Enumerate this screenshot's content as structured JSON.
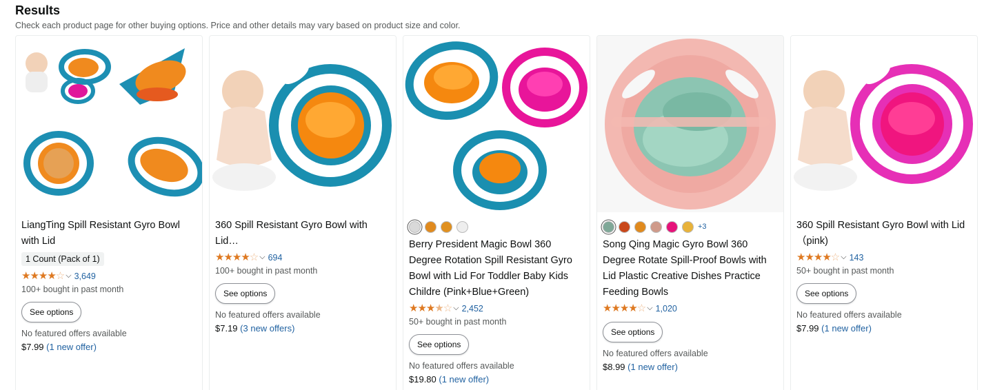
{
  "header": {
    "title": "Results",
    "subtitle": "Check each product page for other buying options. Price and other details may vary based on product size and color."
  },
  "products": [
    {
      "title": "LiangTing Spill Resistant Gyro Bowl with Lid",
      "variant": "1 Count (Pack of 1)",
      "rating": 4.0,
      "rating_count": "3,649",
      "bought": "100+ bought in past month",
      "button": "See options",
      "no_featured": "No featured offers available",
      "price": "$7.99",
      "offer": "(1 new offer)"
    },
    {
      "title": "360 Spill Resistant Gyro Bowl with Lid…",
      "rating": 4.0,
      "rating_count": "694",
      "bought": "100+ bought in past month",
      "button": "See options",
      "no_featured": "No featured offers available",
      "price": "$7.19",
      "offer": "(3 new offers)"
    },
    {
      "swatches": [
        "#d9d9d9",
        "#e08a1e",
        "#e0901f",
        "#eeeeee"
      ],
      "title": "Berry President Magic Bowl 360 Degree Rotation Spill Resistant Gyro Bowl with Lid For Toddler Baby Kids Childre (Pink+Blue+Green)",
      "rating": 3.5,
      "rating_count": "2,452",
      "bought": "50+ bought in past month",
      "button": "See options",
      "no_featured": "No featured offers available",
      "price": "$19.80",
      "offer": "(1 new offer)"
    },
    {
      "swatches": [
        "#7fa898",
        "#c9471a",
        "#e08a1e",
        "#cf9a8a",
        "#e6127a",
        "#e8b23a"
      ],
      "more_swatches": "+3",
      "title": "Song Qing Magic Gyro Bowl 360 Degree Rotate Spill-Proof Bowls with Lid Plastic Creative Dishes Practice Feeding Bowls",
      "rating": 4.0,
      "rating_count": "1,020",
      "button": "See options",
      "no_featured": "No featured offers available",
      "price": "$8.99",
      "offer": "(1 new offer)"
    },
    {
      "title": "360 Spill Resistant Gyro Bowl with Lid （pink)",
      "rating": 4.0,
      "rating_count": "143",
      "bought": "50+ bought in past month",
      "button": "See options",
      "no_featured": "No featured offers available",
      "price": "$7.99",
      "offer": "(1 new offer)"
    }
  ],
  "colors": {
    "star": "#de7921",
    "link": "#2162a1",
    "muted": "#565959"
  },
  "icons": {
    "star": "star-icon",
    "dropdown": "chevron-down-icon"
  }
}
